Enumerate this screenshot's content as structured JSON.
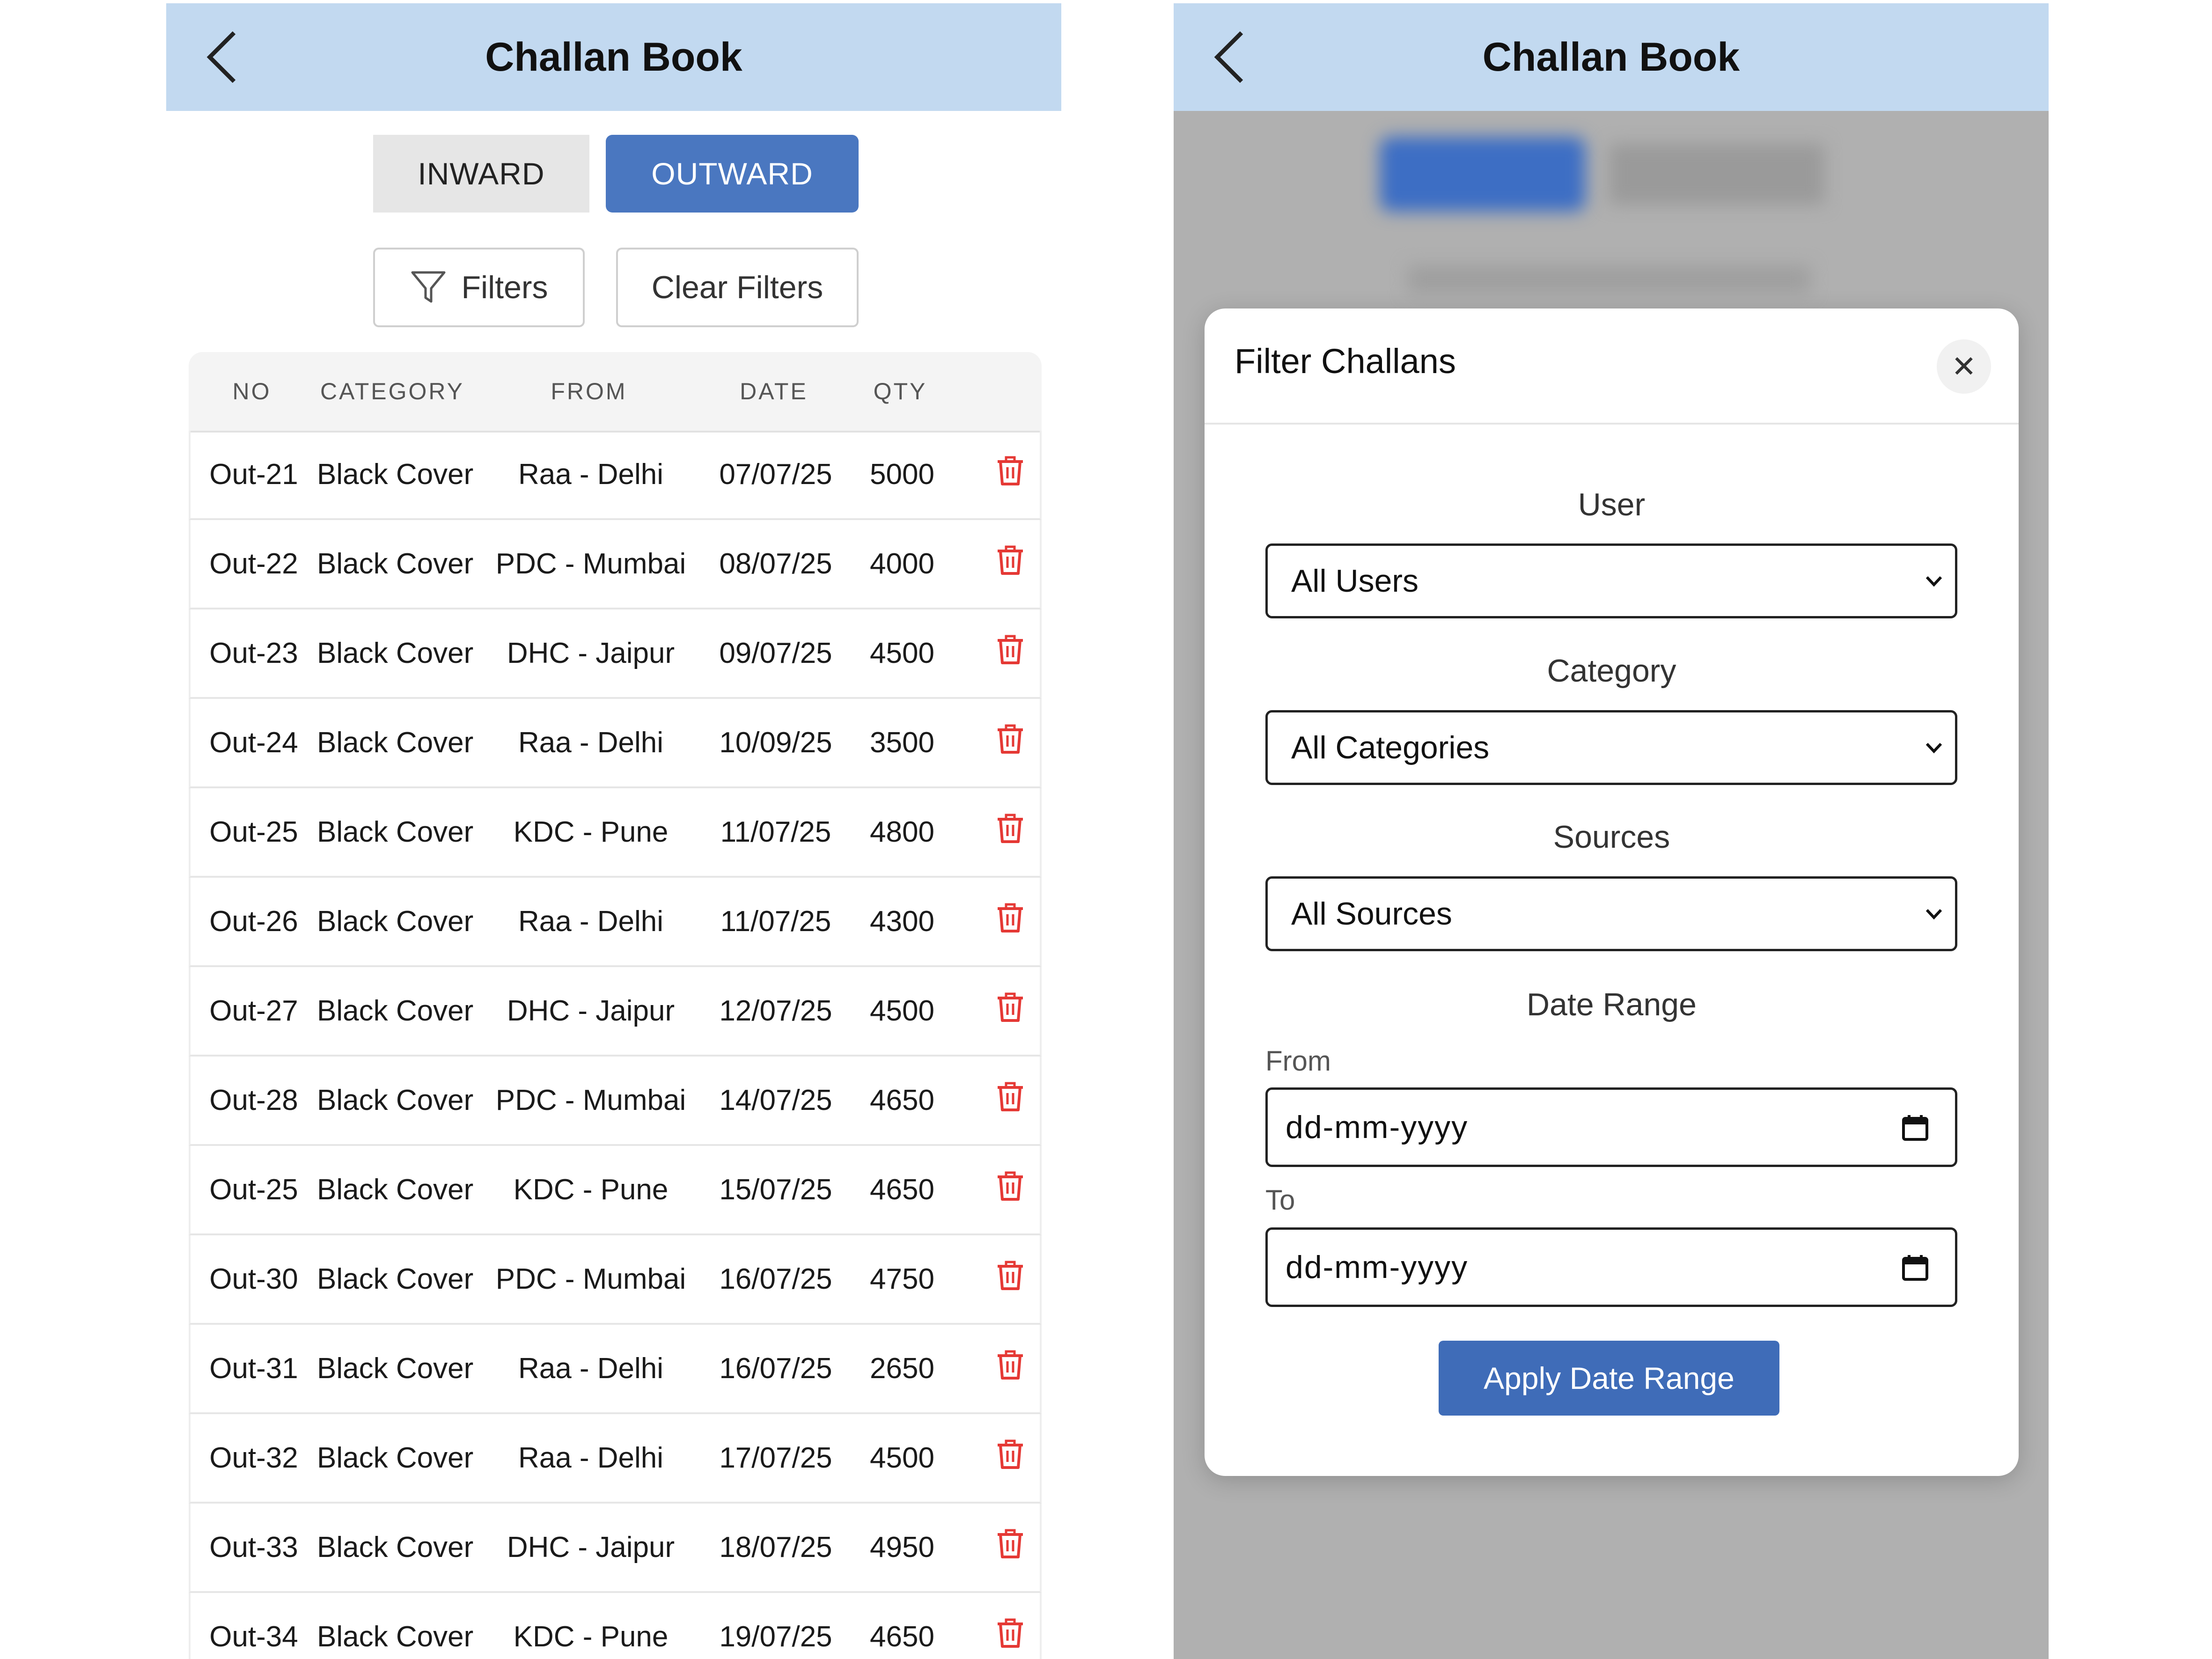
{
  "left_screen": {
    "header": {
      "title": "Challan Book"
    },
    "toggle": {
      "inward_label": "INWARD",
      "outward_label": "OUTWARD",
      "active": "OUTWARD"
    },
    "actions": {
      "filters_label": "Filters",
      "clear_filters_label": "Clear Filters"
    },
    "table": {
      "columns": [
        "NO",
        "CATEGORY",
        "FROM",
        "DATE",
        "QTY"
      ],
      "rows": [
        {
          "no": "Out-21",
          "category": "Black Cover",
          "from": "Raa - Delhi",
          "date": "07/07/25",
          "qty": "5000"
        },
        {
          "no": "Out-22",
          "category": "Black Cover",
          "from": "PDC - Mumbai",
          "date": "08/07/25",
          "qty": "4000"
        },
        {
          "no": "Out-23",
          "category": "Black Cover",
          "from": "DHC - Jaipur",
          "date": "09/07/25",
          "qty": "4500"
        },
        {
          "no": "Out-24",
          "category": "Black Cover",
          "from": "Raa - Delhi",
          "date": "10/09/25",
          "qty": "3500"
        },
        {
          "no": "Out-25",
          "category": "Black Cover",
          "from": "KDC - Pune",
          "date": "11/07/25",
          "qty": "4800"
        },
        {
          "no": "Out-26",
          "category": "Black Cover",
          "from": "Raa - Delhi",
          "date": "11/07/25",
          "qty": "4300"
        },
        {
          "no": "Out-27",
          "category": "Black Cover",
          "from": "DHC - Jaipur",
          "date": "12/07/25",
          "qty": "4500"
        },
        {
          "no": "Out-28",
          "category": "Black Cover",
          "from": "PDC - Mumbai",
          "date": "14/07/25",
          "qty": "4650"
        },
        {
          "no": "Out-25",
          "category": "Black Cover",
          "from": "KDC - Pune",
          "date": "15/07/25",
          "qty": "4650"
        },
        {
          "no": "Out-30",
          "category": "Black Cover",
          "from": "PDC - Mumbai",
          "date": "16/07/25",
          "qty": "4750"
        },
        {
          "no": "Out-31",
          "category": "Black Cover",
          "from": "Raa - Delhi",
          "date": "16/07/25",
          "qty": "2650"
        },
        {
          "no": "Out-32",
          "category": "Black Cover",
          "from": "Raa - Delhi",
          "date": "17/07/25",
          "qty": "4500"
        },
        {
          "no": "Out-33",
          "category": "Black Cover",
          "from": "DHC - Jaipur",
          "date": "18/07/25",
          "qty": "4950"
        },
        {
          "no": "Out-34",
          "category": "Black Cover",
          "from": "KDC - Pune",
          "date": "19/07/25",
          "qty": "4650"
        }
      ],
      "row_icon": "trash-icon"
    }
  },
  "right_screen": {
    "header": {
      "title": "Challan Book"
    },
    "modal": {
      "title": "Filter Challans",
      "close_icon": "close-icon",
      "user": {
        "label": "User",
        "value": "All Users"
      },
      "category": {
        "label": "Category",
        "value": "All Categories"
      },
      "sources": {
        "label": "Sources",
        "value": "All Sources"
      },
      "date_range": {
        "label": "Date Range",
        "from_label": "From",
        "from_value": "dd-mm-yyyy",
        "to_label": "To",
        "to_value": "dd-mm-yyyy"
      },
      "apply_label": "Apply Date Range"
    }
  },
  "colors": {
    "header_bg": "#c2d9f0",
    "accent_blue": "#4a77c0",
    "apply_blue": "#3f6cb8",
    "delete_red": "#e53935",
    "overlay_gray": "#b0b0b0"
  }
}
